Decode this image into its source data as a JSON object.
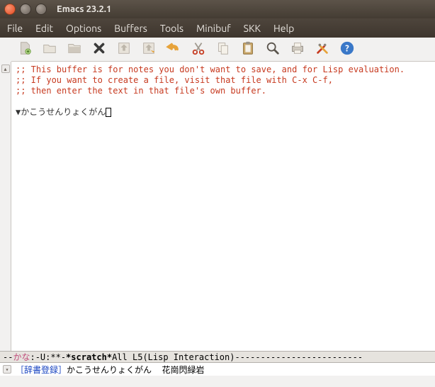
{
  "window": {
    "title": "Emacs 23.2.1"
  },
  "menu": {
    "file": "File",
    "edit": "Edit",
    "options": "Options",
    "buffers": "Buffers",
    "tools": "Tools",
    "minibuf": "Minibuf",
    "skk": "SKK",
    "help": "Help"
  },
  "toolbar_icons": {
    "new": "new-file-icon",
    "open": "open-file-icon",
    "dir": "directory-icon",
    "kill": "close-icon",
    "save": "save-icon",
    "saveas": "save-as-icon",
    "undo": "undo-icon",
    "cut": "cut-icon",
    "copy": "copy-icon",
    "paste": "paste-icon",
    "search": "search-icon",
    "print": "print-icon",
    "prefs": "preferences-icon",
    "help": "help-icon"
  },
  "buffer": {
    "comment1": ";; This buffer is for notes you don't want to save, and for Lisp evaluation.",
    "comment2": ";; If you want to create a file, visit that file with C-x C-f,",
    "comment3": ";; then enter the text in that file's own buffer.",
    "marker": "▼",
    "input": "かこうせんりょくがん"
  },
  "modeline": {
    "kana": "かな",
    "flags": ":-U:**-",
    "bufname": "*scratch*",
    "pos": "All L5",
    "mode": "(Lisp Interaction)",
    "dashes": "-------------------------"
  },
  "minibuf": {
    "tag": "［辞書登録］",
    "reading": "かこうせんりょくがん",
    "entry": "花崗閃緑岩"
  }
}
